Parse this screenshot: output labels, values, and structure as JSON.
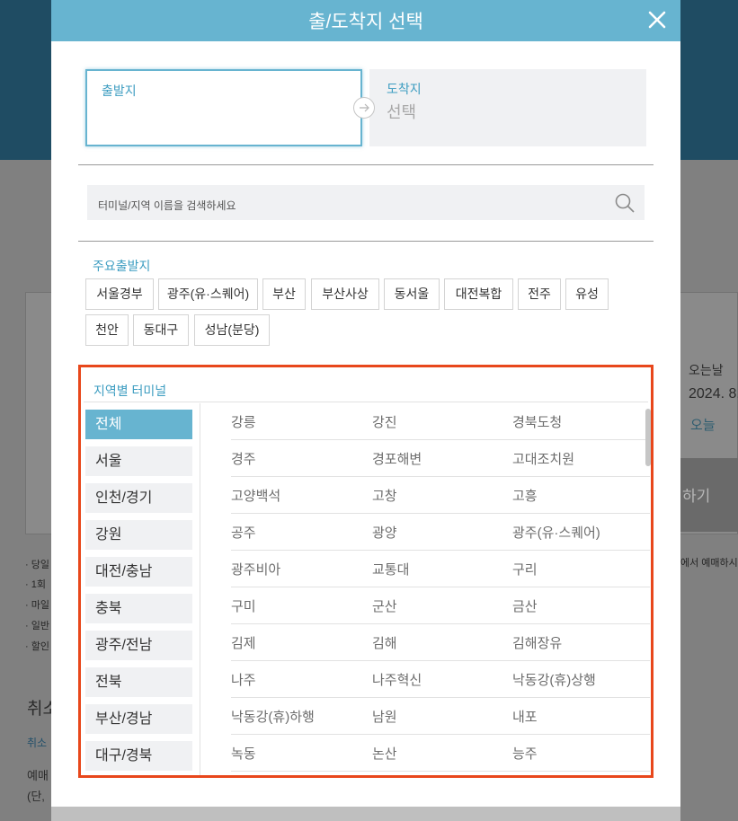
{
  "background": {
    "right_label": "오는날",
    "right_date": "2024. 8.",
    "right_today": "오늘",
    "right_button": "하기",
    "right_note": "에서 예매하시",
    "notes": [
      "· 당일",
      "· 1회",
      "· 마일",
      "· 일반",
      "· 할인"
    ],
    "cancel_heading": "취소",
    "cancel_link": "취소",
    "reserve_text": "예매",
    "single_text": "(단,"
  },
  "modal": {
    "title": "출/도착지 선택",
    "departure_label": "출발지",
    "departure_value": "",
    "arrival_label": "도착지",
    "arrival_value": "선택",
    "search_placeholder": "터미널/지역 이름을 검색하세요",
    "major_label": "주요출발지",
    "major_chips": [
      "서울경부",
      "광주(유·스퀘어)",
      "부산",
      "부산사상",
      "동서울",
      "대전복합",
      "전주",
      "유성",
      "천안",
      "동대구",
      "성남(분당)"
    ],
    "region_title": "지역별 터미널",
    "regions": [
      "전체",
      "서울",
      "인천/경기",
      "강원",
      "대전/충남",
      "충북",
      "광주/전남",
      "전북",
      "부산/경남",
      "대구/경북"
    ],
    "active_region": "전체",
    "terminals": [
      [
        "강릉",
        "강진",
        "경북도청"
      ],
      [
        "경주",
        "경포해변",
        "고대조치원"
      ],
      [
        "고양백석",
        "고창",
        "고흥"
      ],
      [
        "공주",
        "광양",
        "광주(유·스퀘어)"
      ],
      [
        "광주비아",
        "교통대",
        "구리"
      ],
      [
        "구미",
        "군산",
        "금산"
      ],
      [
        "김제",
        "김해",
        "김해장유"
      ],
      [
        "나주",
        "나주혁신",
        "낙동강(휴)상행"
      ],
      [
        "낙동강(휴)하행",
        "남원",
        "내포"
      ],
      [
        "녹동",
        "논산",
        "능주"
      ]
    ]
  },
  "colors": {
    "accent": "#67b4d0",
    "accent_text": "#3d9dc1",
    "highlight_border": "#e8471b"
  },
  "icons": {
    "close": "close-icon",
    "arrow": "arrow-right-icon",
    "search": "search-icon"
  }
}
